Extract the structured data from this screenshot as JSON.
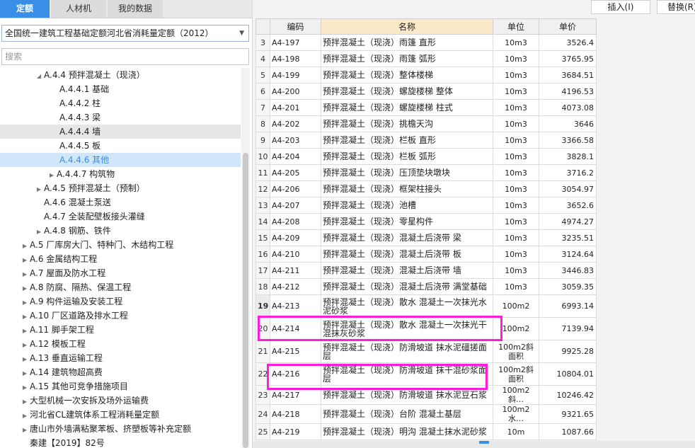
{
  "tabs": [
    {
      "label": "定额"
    },
    {
      "label": "人材机"
    },
    {
      "label": "我的数据"
    }
  ],
  "library_select": "全国统一建筑工程基础定额河北省消耗量定额（2012）",
  "search_placeholder": "搜索",
  "tree": [
    {
      "label": "A.4.4 预拌混凝土（现浇）",
      "expander": "◢"
    },
    {
      "label": "A.4.4.1 基础",
      "expander": ""
    },
    {
      "label": "A.4.4.2 柱",
      "expander": ""
    },
    {
      "label": "A.4.4.3 梁",
      "expander": ""
    },
    {
      "label": "A.4.4.4 墙",
      "expander": ""
    },
    {
      "label": "A.4.4.5 板",
      "expander": ""
    },
    {
      "label": "A.4.4.6 其他",
      "expander": ""
    },
    {
      "label": "A.4.4.7 构筑物",
      "expander": "▶"
    },
    {
      "label": "A.4.5 预拌混凝土（预制）",
      "expander": "▶"
    },
    {
      "label": "A.4.6 混凝土泵送",
      "expander": ""
    },
    {
      "label": "A.4.7 全装配壁板接头灌缝",
      "expander": ""
    },
    {
      "label": "A.4.8 钢筋、铁件",
      "expander": "▶"
    },
    {
      "label": "A.5 厂库房大门、特种门、木结构工程",
      "expander": "▶"
    },
    {
      "label": "A.6 金属结构工程",
      "expander": "▶"
    },
    {
      "label": "A.7 屋面及防水工程",
      "expander": "▶"
    },
    {
      "label": "A.8 防腐、隔热、保温工程",
      "expander": "▶"
    },
    {
      "label": "A.9 构件运输及安装工程",
      "expander": "▶"
    },
    {
      "label": "A.10 厂区道路及排水工程",
      "expander": "▶"
    },
    {
      "label": "A.11 脚手架工程",
      "expander": "▶"
    },
    {
      "label": "A.12 模板工程",
      "expander": "▶"
    },
    {
      "label": "A.13 垂直运输工程",
      "expander": "▶"
    },
    {
      "label": "A.14 建筑物超高费",
      "expander": "▶"
    },
    {
      "label": "A.15 其他可竞争措施项目",
      "expander": "▶"
    },
    {
      "label": "大型机械一次安拆及场外运输费",
      "expander": "▶"
    },
    {
      "label": "河北省CL建筑体系工程消耗量定额",
      "expander": "▶"
    },
    {
      "label": "唐山市外墙满粘聚苯板、挤塑板等补充定额",
      "expander": "▶"
    },
    {
      "label": "秦建【2019】82号",
      "expander": ""
    }
  ],
  "toolbar": {
    "insert_label": "插入(I)",
    "replace_label": "替换(R)"
  },
  "table": {
    "headers": {
      "code": "编码",
      "name": "名称",
      "unit": "单位",
      "price": "单价"
    },
    "rows": [
      {
        "idx": "3",
        "code": "A4-197",
        "name": "预拌混凝土（现浇）雨篷 直形",
        "unit": "10m3",
        "price": "3526.4"
      },
      {
        "idx": "4",
        "code": "A4-198",
        "name": "预拌混凝土（现浇）雨篷 弧形",
        "unit": "10m3",
        "price": "3765.95"
      },
      {
        "idx": "5",
        "code": "A4-199",
        "name": "预拌混凝土（现浇）整体楼梯",
        "unit": "10m3",
        "price": "3684.51"
      },
      {
        "idx": "6",
        "code": "A4-200",
        "name": "预拌混凝土（现浇）螺旋楼梯 整体",
        "unit": "10m3",
        "price": "4196.53"
      },
      {
        "idx": "7",
        "code": "A4-201",
        "name": "预拌混凝土（现浇）螺旋楼梯 柱式",
        "unit": "10m3",
        "price": "4073.08"
      },
      {
        "idx": "8",
        "code": "A4-202",
        "name": "预拌混凝土（现浇）挑檐天沟",
        "unit": "10m3",
        "price": "3646"
      },
      {
        "idx": "9",
        "code": "A4-203",
        "name": "预拌混凝土（现浇）栏板 直形",
        "unit": "10m3",
        "price": "3366.58"
      },
      {
        "idx": "10",
        "code": "A4-204",
        "name": "预拌混凝土（现浇）栏板 弧形",
        "unit": "10m3",
        "price": "3828.1"
      },
      {
        "idx": "11",
        "code": "A4-205",
        "name": "预拌混凝土（现浇）压顶垫块墩块",
        "unit": "10m3",
        "price": "3716.2"
      },
      {
        "idx": "12",
        "code": "A4-206",
        "name": "预拌混凝土（现浇）框架柱接头",
        "unit": "10m3",
        "price": "3054.97"
      },
      {
        "idx": "13",
        "code": "A4-207",
        "name": "预拌混凝土（现浇）池槽",
        "unit": "10m3",
        "price": "3652.6"
      },
      {
        "idx": "14",
        "code": "A4-208",
        "name": "预拌混凝土（现浇）零星构件",
        "unit": "10m3",
        "price": "4974.27"
      },
      {
        "idx": "15",
        "code": "A4-209",
        "name": "预拌混凝土（现浇）混凝土后浇带 梁",
        "unit": "10m3",
        "price": "3235.51"
      },
      {
        "idx": "16",
        "code": "A4-210",
        "name": "预拌混凝土（现浇）混凝土后浇带 板",
        "unit": "10m3",
        "price": "3124.64"
      },
      {
        "idx": "17",
        "code": "A4-211",
        "name": "预拌混凝土（现浇）混凝土后浇带 墙",
        "unit": "10m3",
        "price": "3446.83"
      },
      {
        "idx": "18",
        "code": "A4-212",
        "name": "预拌混凝土（现浇）混凝土后浇带 满堂基础",
        "unit": "10m3",
        "price": "3059.35"
      },
      {
        "idx": "19",
        "code": "A4-213",
        "name": "预拌混凝土（现浇）散水 混凝土一次抹光水泥砂浆",
        "unit": "100m2",
        "price": "6993.14"
      },
      {
        "idx": "20",
        "code": "A4-214",
        "name": "预拌混凝土（现浇）散水 混凝土一次抹光干混抹灰砂浆",
        "unit": "100m2",
        "price": "7139.94"
      },
      {
        "idx": "21",
        "code": "A4-215",
        "name": "预拌混凝土（现浇）防滑坡道 抹水泥礓搓面层",
        "unit": "100m2斜面积",
        "price": "9925.28"
      },
      {
        "idx": "22",
        "code": "A4-216",
        "name": "预拌混凝土（现浇）防滑坡道 抹干混砂浆面层",
        "unit": "100m2斜面积",
        "price": "10804.01"
      },
      {
        "idx": "23",
        "code": "A4-217",
        "name": "预拌混凝土（现浇）防滑坡道 抹水泥豆石浆",
        "unit": "100m2斜…",
        "price": "10246.42"
      },
      {
        "idx": "24",
        "code": "A4-218",
        "name": "预拌混凝土（现浇）台阶 混凝土基层",
        "unit": "100m2水…",
        "price": "9321.65"
      },
      {
        "idx": "25",
        "code": "A4-219",
        "name": "预拌混凝土（现浇）明沟 混凝土抹水泥砂浆",
        "unit": "10m",
        "price": "1087.66"
      }
    ]
  },
  "colors": {
    "accent": "#3a8ee6",
    "highlight": "#ff1cdc"
  }
}
